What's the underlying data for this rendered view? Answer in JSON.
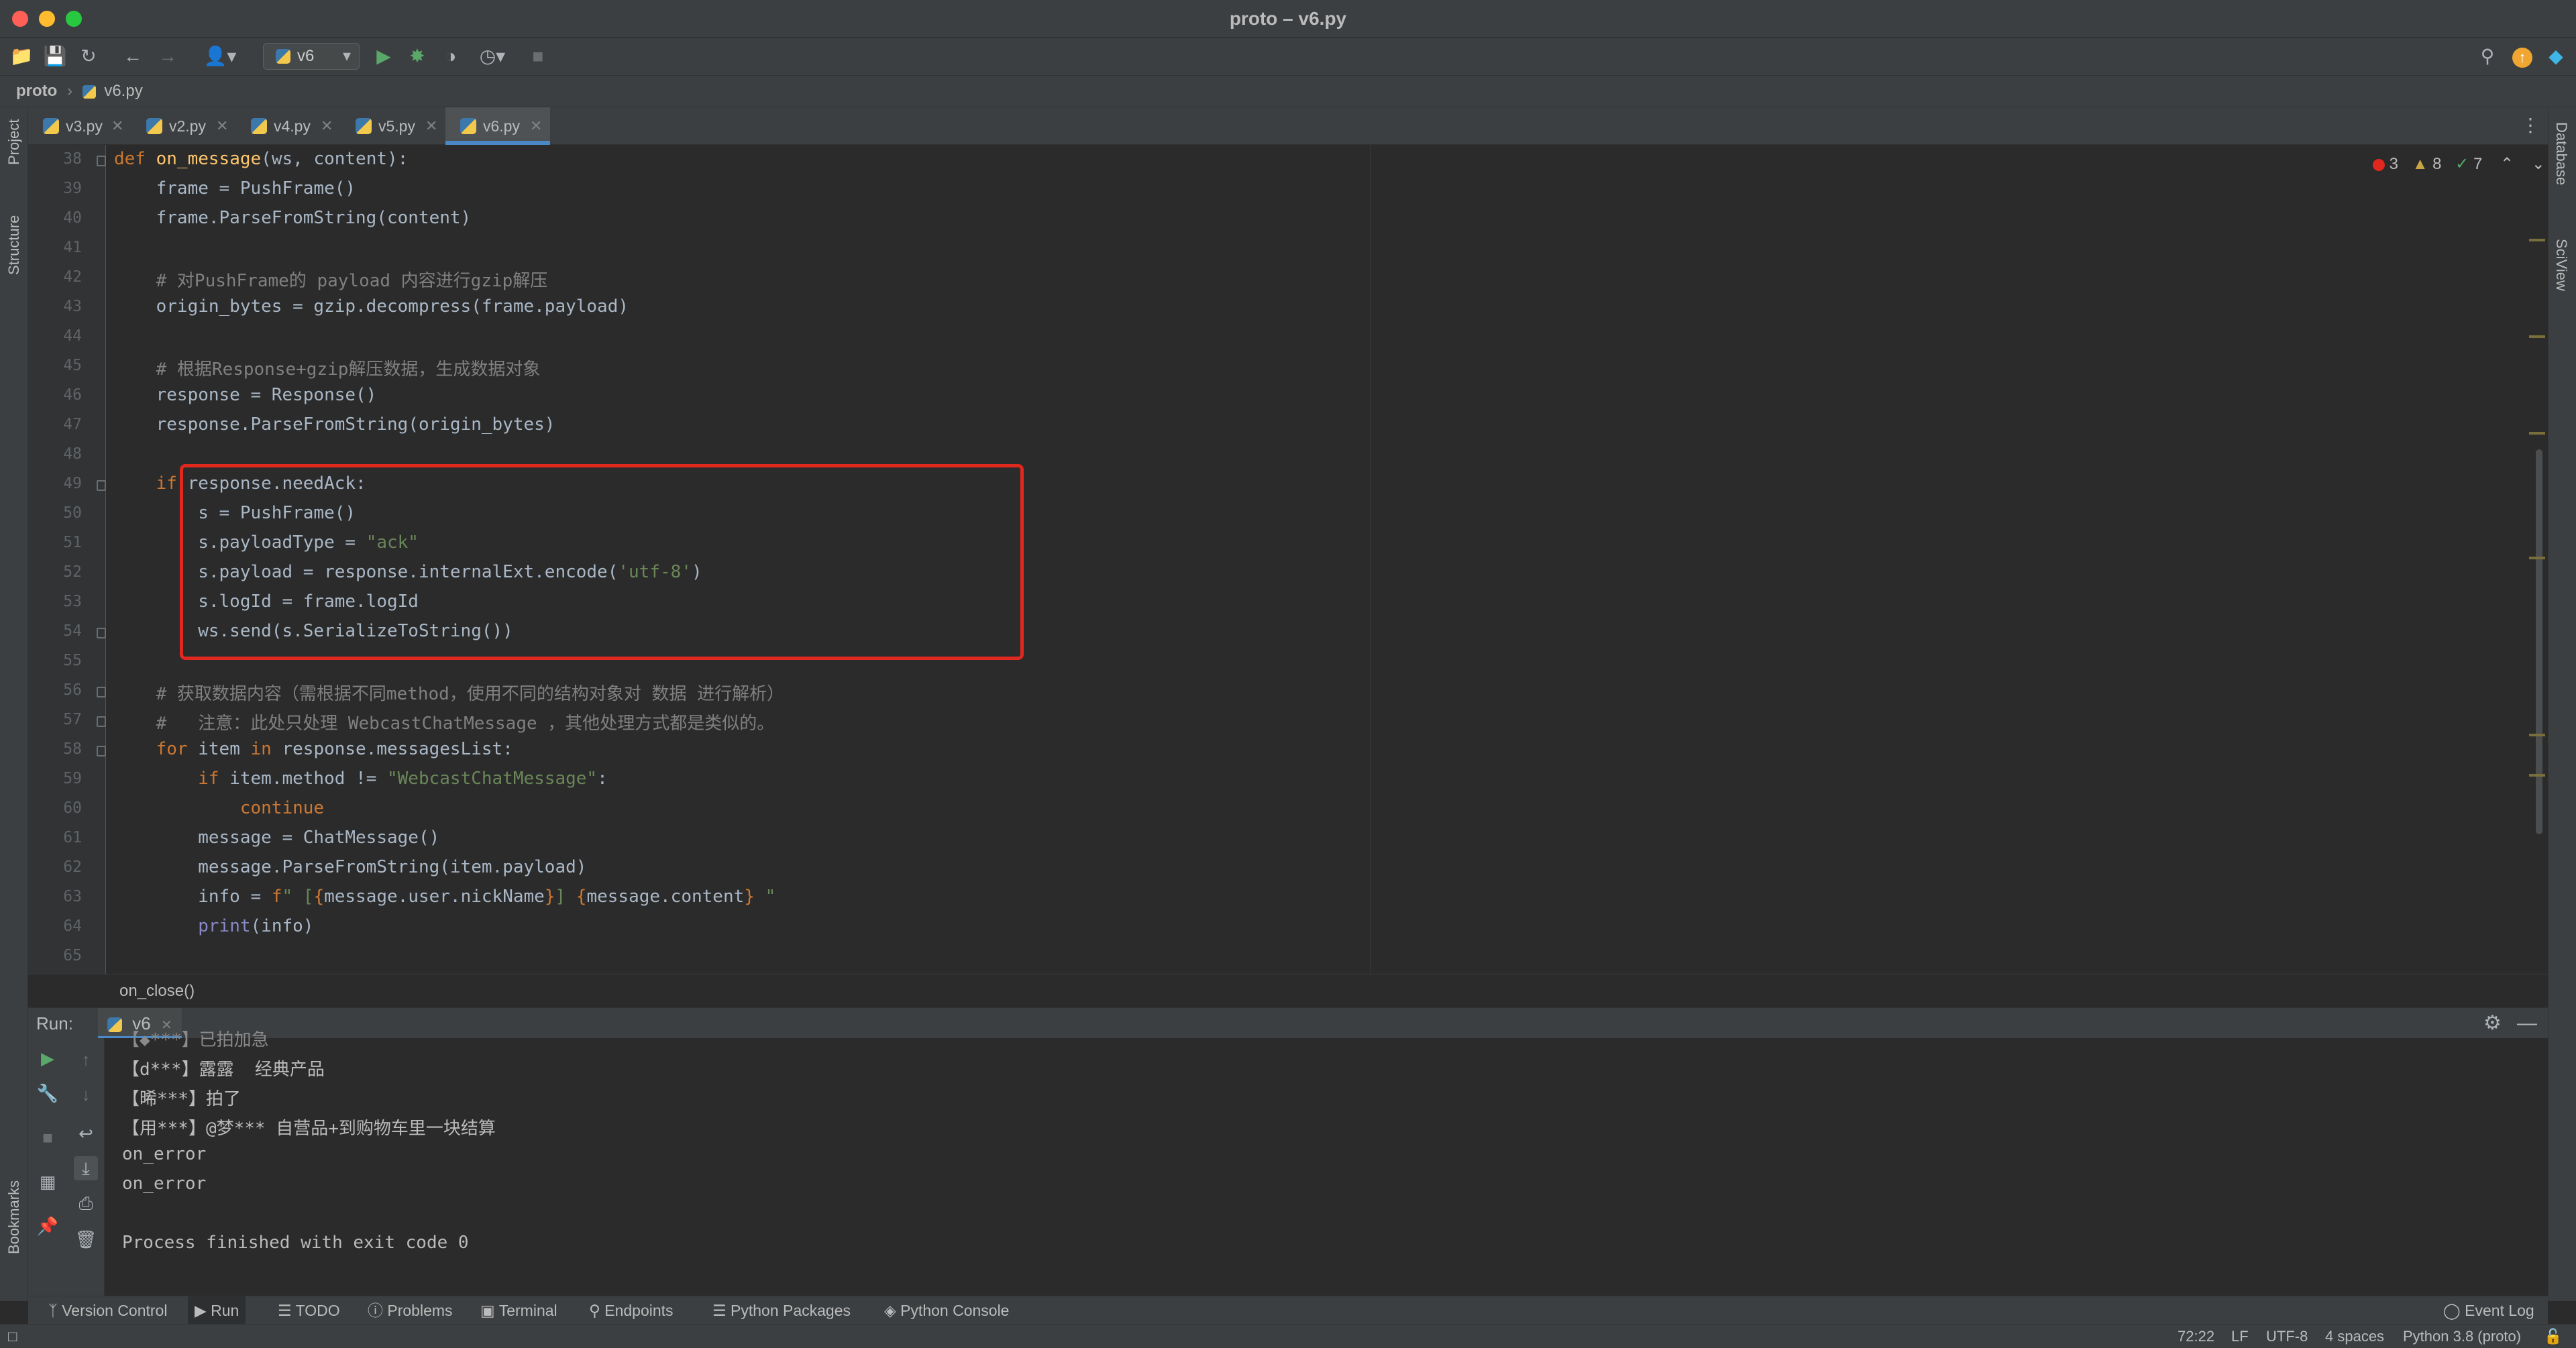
{
  "window": {
    "title": "proto – v6.py"
  },
  "toolbar": {
    "run_config": "v6"
  },
  "breadcrumb": {
    "project": "proto",
    "file": "v6.py"
  },
  "left_strip": {
    "project": "Project",
    "structure": "Structure",
    "bookmarks": "Bookmarks"
  },
  "right_strip": {
    "database": "Database",
    "sciview": "SciView"
  },
  "tabs": [
    {
      "label": "v3.py",
      "active": false
    },
    {
      "label": "v2.py",
      "active": false
    },
    {
      "label": "v4.py",
      "active": false
    },
    {
      "label": "v5.py",
      "active": false
    },
    {
      "label": "v6.py",
      "active": true
    }
  ],
  "inspection": {
    "errors": "3",
    "warnings": "8",
    "weak": "7"
  },
  "code_lines": [
    {
      "n": "38",
      "text": "def on_message(ws, content):"
    },
    {
      "n": "39",
      "text": "    frame = PushFrame()"
    },
    {
      "n": "40",
      "text": "    frame.ParseFromString(content)"
    },
    {
      "n": "41",
      "text": ""
    },
    {
      "n": "42",
      "text": "    # 对PushFrame的 payload 内容进行gzip解压"
    },
    {
      "n": "43",
      "text": "    origin_bytes = gzip.decompress(frame.payload)"
    },
    {
      "n": "44",
      "text": ""
    },
    {
      "n": "45",
      "text": "    # 根据Response+gzip解压数据，生成数据对象"
    },
    {
      "n": "46",
      "text": "    response = Response()"
    },
    {
      "n": "47",
      "text": "    response.ParseFromString(origin_bytes)"
    },
    {
      "n": "48",
      "text": ""
    },
    {
      "n": "49",
      "text": "    if response.needAck:"
    },
    {
      "n": "50",
      "text": "        s = PushFrame()"
    },
    {
      "n": "51",
      "text": "        s.payloadType = \"ack\""
    },
    {
      "n": "52",
      "text": "        s.payload = response.internalExt.encode('utf-8')"
    },
    {
      "n": "53",
      "text": "        s.logId = frame.logId"
    },
    {
      "n": "54",
      "text": "        ws.send(s.SerializeToString())"
    },
    {
      "n": "55",
      "text": ""
    },
    {
      "n": "56",
      "text": "    # 获取数据内容（需根据不同method，使用不同的结构对象对 数据 进行解析）"
    },
    {
      "n": "57",
      "text": "    #   注意：此处只处理 WebcastChatMessage ，其他处理方式都是类似的。"
    },
    {
      "n": "58",
      "text": "    for item in response.messagesList:"
    },
    {
      "n": "59",
      "text": "        if item.method != \"WebcastChatMessage\":"
    },
    {
      "n": "60",
      "text": "            continue"
    },
    {
      "n": "61",
      "text": "        message = ChatMessage()"
    },
    {
      "n": "62",
      "text": "        message.ParseFromString(item.payload)"
    },
    {
      "n": "63",
      "text": "        info = f\" [{message.user.nickName}] {message.content} \""
    },
    {
      "n": "64",
      "text": "        print(info)"
    },
    {
      "n": "65",
      "text": ""
    }
  ],
  "method_crumb": "on_close()",
  "run": {
    "label": "Run:",
    "tab": "v6",
    "output": [
      "【d***】露露  经典产品",
      "【晞***】拍了",
      "【用***】@梦*** 自营品+到购物车里一块结算",
      "on_error",
      "on_error",
      "",
      "Process finished with exit code 0"
    ]
  },
  "bottom_tabs": [
    {
      "label": "Version Control",
      "icon": "branch-icon"
    },
    {
      "label": "Run",
      "icon": "play-icon",
      "active": true
    },
    {
      "label": "TODO",
      "icon": "list-icon"
    },
    {
      "label": "Problems",
      "icon": "info-icon"
    },
    {
      "label": "Terminal",
      "icon": "terminal-icon"
    },
    {
      "label": "Endpoints",
      "icon": "endpoints-icon"
    },
    {
      "label": "Python Packages",
      "icon": "layers-icon"
    },
    {
      "label": "Python Console",
      "icon": "python-icon"
    }
  ],
  "event_log": "Event Log",
  "status": {
    "position": "72:22",
    "line_sep": "LF",
    "encoding": "UTF-8",
    "indent": "4 spaces",
    "interpreter": "Python 3.8 (proto)"
  }
}
